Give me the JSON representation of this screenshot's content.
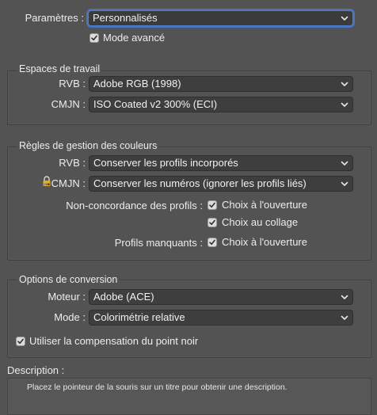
{
  "settings": {
    "label": "Paramètres :",
    "value": "Personnalisés",
    "advanced_mode_label": "Mode avancé",
    "advanced_mode_checked": true
  },
  "working_spaces": {
    "title": "Espaces de travail",
    "rgb_label": "RVB :",
    "rgb_value": "Adobe RGB (1998)",
    "cmyk_label": "CMJN :",
    "cmyk_value": "ISO Coated v2 300% (ECI)"
  },
  "color_management": {
    "title": "Règles de gestion des couleurs",
    "rgb_label": "RVB :",
    "rgb_value": "Conserver les profils incorporés",
    "cmyk_label": "CMJN :",
    "cmyk_value": "Conserver les numéros (ignorer les profils liés)",
    "mismatch_label": "Non-concordance des profils :",
    "mismatch_ask_opening": "Choix à l'ouverture",
    "mismatch_ask_pasting": "Choix au collage",
    "missing_label": "Profils manquants :",
    "missing_ask_opening": "Choix à l'ouverture"
  },
  "conversion": {
    "title": "Options de conversion",
    "engine_label": "Moteur :",
    "engine_value": "Adobe (ACE)",
    "intent_label": "Mode :",
    "intent_value": "Colorimétrie relative",
    "black_point_label": "Utiliser la compensation du point noir",
    "black_point_checked": true
  },
  "description": {
    "title": "Description :",
    "text": "Placez le pointeur de la souris sur un titre pour obtenir une description."
  },
  "colors": {
    "background": "#535353",
    "focus_ring": "#4a7fd4",
    "field": "#3e3e3e"
  }
}
